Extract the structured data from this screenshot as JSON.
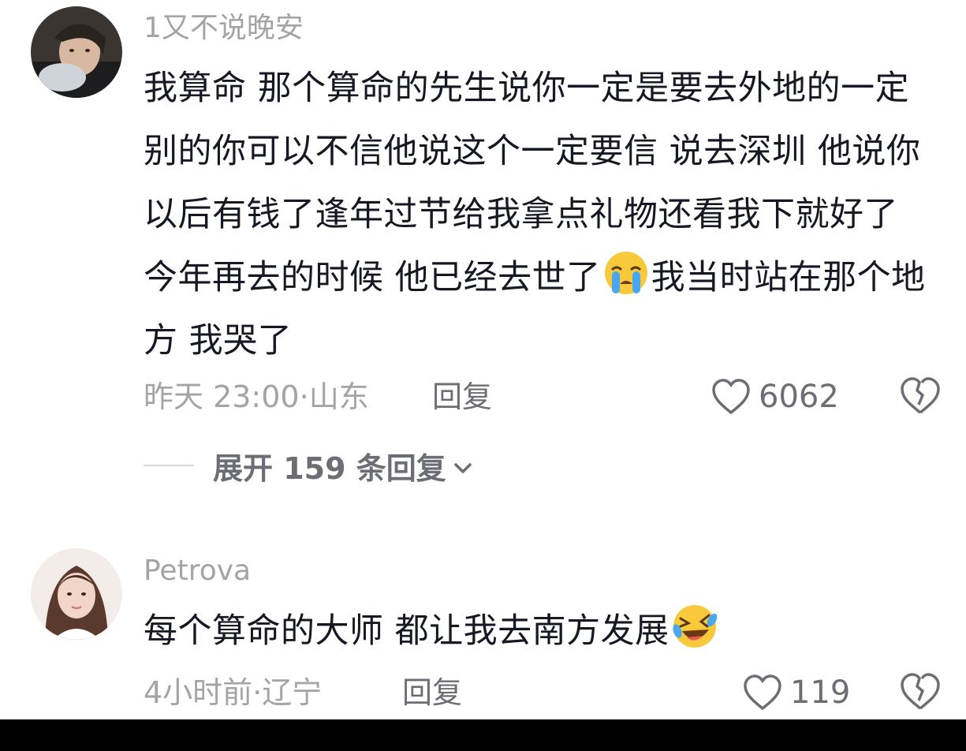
{
  "comments": [
    {
      "avatar_icon": "user-avatar-photo",
      "username": "1又不说晚安",
      "content_parts": [
        "我算命 那个算命的先生说你一定是要去外地的一定 别的你可以不信他说这个一定要信 说去深圳 他说你以后有钱了逢年过节给我拿点礼物还看我下就好了 今年再去的时候 他已经去世了",
        "我当时站在那个地方 我哭了"
      ],
      "emoji_icon": "loudly-crying-face-emoji",
      "time": "昨天 23:00",
      "location": "山东",
      "reply_label": "回复",
      "like_count": "6062",
      "expand_label": "展开 159 条回复"
    },
    {
      "avatar_icon": "user-avatar-photo",
      "username": "Petrova",
      "content": "每个算命的大师 都让我去南方发展",
      "emoji_icon": "rolling-laughing-face-emoji",
      "time": "4小时前",
      "location": "辽宁",
      "reply_label": "回复",
      "like_count": "119"
    }
  ],
  "separator": "·",
  "colors": {
    "text_primary": "#161823",
    "text_secondary": "#a3a3a8",
    "action_text": "#6d6d75",
    "bottom_bar": "#000000"
  }
}
